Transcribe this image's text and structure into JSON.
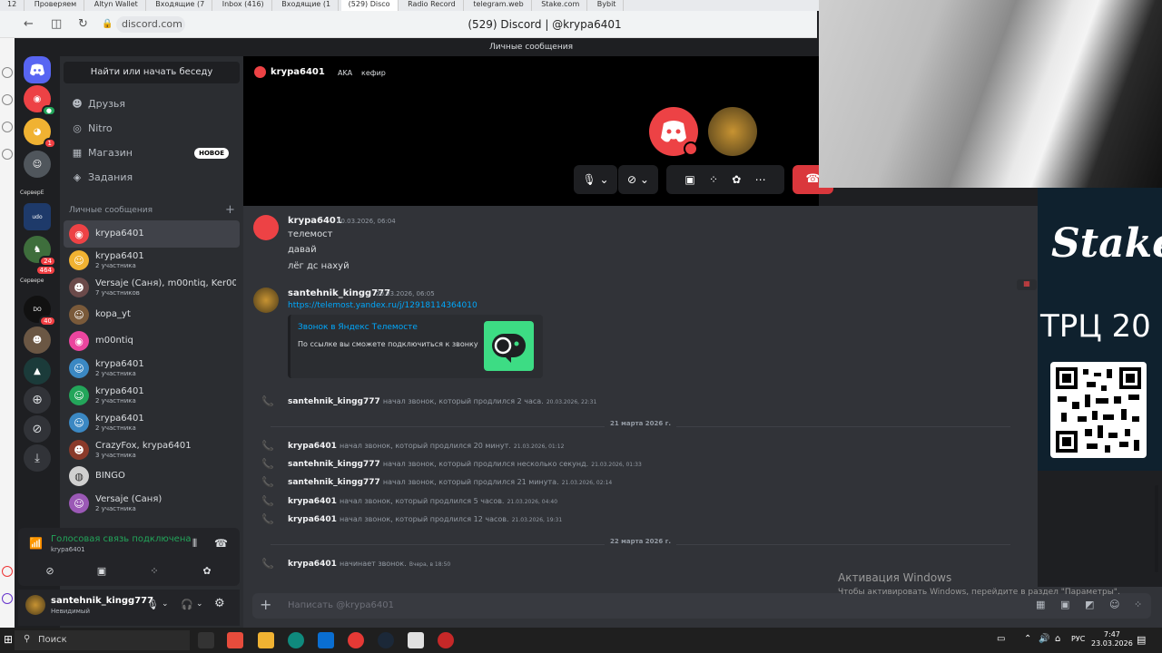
{
  "browser": {
    "tabs": [
      "12",
      "Проверяем",
      "Altyn Wallet",
      "Входящие (7",
      "Inbox (416)",
      "Входящие (1",
      "(529) Disco",
      "Radio Record",
      "telegram.web",
      "Stake.com",
      "Bybit"
    ],
    "url": "discord.com",
    "page_title": "(529) Discord | @krypa6401"
  },
  "discord": {
    "pm_title": "Личные сообщения",
    "search": "Найти или начать беседу",
    "nav": [
      {
        "label": "Друзья",
        "icon": "friends-icon"
      },
      {
        "label": "Nitro",
        "icon": "nitro-icon"
      },
      {
        "label": "Магазин",
        "icon": "shop-icon",
        "badge": "НОВОЕ"
      },
      {
        "label": "Задания",
        "icon": "quests-icon"
      }
    ],
    "dm_header": "Личные сообщения",
    "dms": [
      {
        "name": "krypa6401",
        "sub": ""
      },
      {
        "name": "krypa6401",
        "sub": "2 участника"
      },
      {
        "name": "Versaje (Саня), m00ntiq, Ker00...",
        "sub": "7 участников"
      },
      {
        "name": "kopa_yt",
        "sub": ""
      },
      {
        "name": "m00ntiq",
        "sub": ""
      },
      {
        "name": "krypa6401",
        "sub": "2 участника"
      },
      {
        "name": "krypa6401",
        "sub": "2 участника"
      },
      {
        "name": "krypa6401",
        "sub": "2 участника"
      },
      {
        "name": "CrazyFox, krypa6401",
        "sub": "3 участника"
      },
      {
        "name": "BINGO",
        "sub": ""
      },
      {
        "name": "Versaje (Саня)",
        "sub": "2 участника"
      }
    ],
    "server_labels": {
      "s1": "СерверЕ",
      "s2": "Сервере"
    },
    "server_badges": {
      "b1": "1",
      "b2": "24",
      "b3": "464",
      "b4": "40"
    },
    "voice": {
      "status": "Голосовая связь подключена",
      "channel": "krypa6401"
    },
    "user": {
      "name": "santehnik_kingg777",
      "status": "Невидимый"
    },
    "call": {
      "user": "krypa6401",
      "aka": "AKA",
      "nick": "кефир"
    },
    "messages": {
      "m1": {
        "author": "krypa6401",
        "time": "20.03.2026, 06:04",
        "lines": [
          "телемост",
          "давай",
          "лёг дс нахуй"
        ]
      },
      "m2": {
        "author": "santehnik_kingg777",
        "time": "20.03.2026, 06:05",
        "link": "https://telemost.yandex.ru/j/12918114364010",
        "embed_title": "Звонок в Яндекс Телемосте",
        "embed_desc": "По ссылке вы сможете подключиться к звонку"
      }
    },
    "system": [
      {
        "author": "santehnik_kingg777",
        "text": "начал звонок, который продлился 2 часа.",
        "time": "20.03.2026, 22:31"
      },
      {
        "author": "krypa6401",
        "text": "начал звонок, который продлился 20 минут.",
        "time": "21.03.2026, 01:12"
      },
      {
        "author": "santehnik_kingg777",
        "text": "начал звонок, который продлился несколько секунд.",
        "time": "21.03.2026, 01:33"
      },
      {
        "author": "santehnik_kingg777",
        "text": "начал звонок, который продлился 21 минута.",
        "time": "21.03.2026, 02:14"
      },
      {
        "author": "krypa6401",
        "text": "начал звонок, который продлился 5 часов.",
        "time": "21.03.2026, 04:40"
      },
      {
        "author": "krypa6401",
        "text": "начал звонок, который продлился 12 часов.",
        "time": "21.03.2026, 19:31"
      },
      {
        "author": "krypa6401",
        "text": "начинает звонок.",
        "time": "Вчера, в 18:50"
      }
    ],
    "dividers": [
      "21 марта 2026 г.",
      "22 марта 2026 г."
    ],
    "input_placeholder": "Написать @krypa6401"
  },
  "windows": {
    "activation_title": "Активация Windows",
    "activation_text": "Чтобы активировать Windows, перейдите в раздел \"Параметры\".",
    "search": "Поиск",
    "lang": "РУС",
    "time": "7:47",
    "date": "23.03.2026"
  },
  "overlay": {
    "brand": "Stake",
    "text": "ТРЦ 20"
  },
  "colors": {
    "discord_blurple": "#5865f2",
    "online_green": "#23a55a",
    "danger_red": "#da373c",
    "link_blue": "#00a8fc"
  }
}
